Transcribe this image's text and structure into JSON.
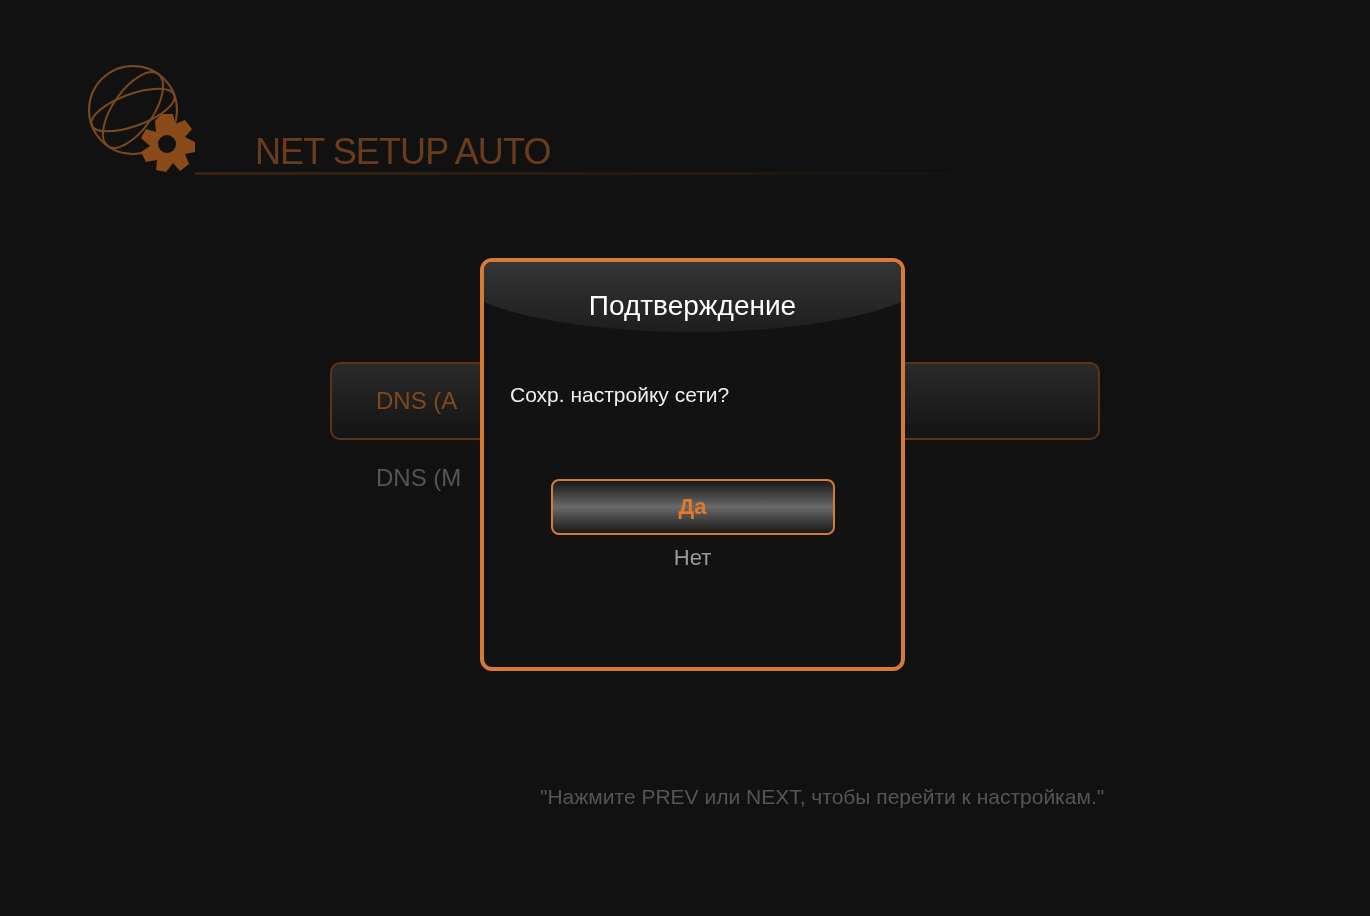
{
  "header": {
    "title": "NET SETUP AUTO"
  },
  "menu": {
    "items": [
      {
        "label": "DNS (A",
        "selected": true
      },
      {
        "label": "DNS (M",
        "selected": false
      }
    ]
  },
  "dialog": {
    "title": "Подтверждение",
    "message": "Сохр. настройку сети?",
    "buttons": [
      {
        "label": "Да",
        "selected": true
      },
      {
        "label": "Нет",
        "selected": false
      }
    ]
  },
  "hint": "\"Нажмите PREV или NEXT, чтобы перейти к настройкам.\""
}
